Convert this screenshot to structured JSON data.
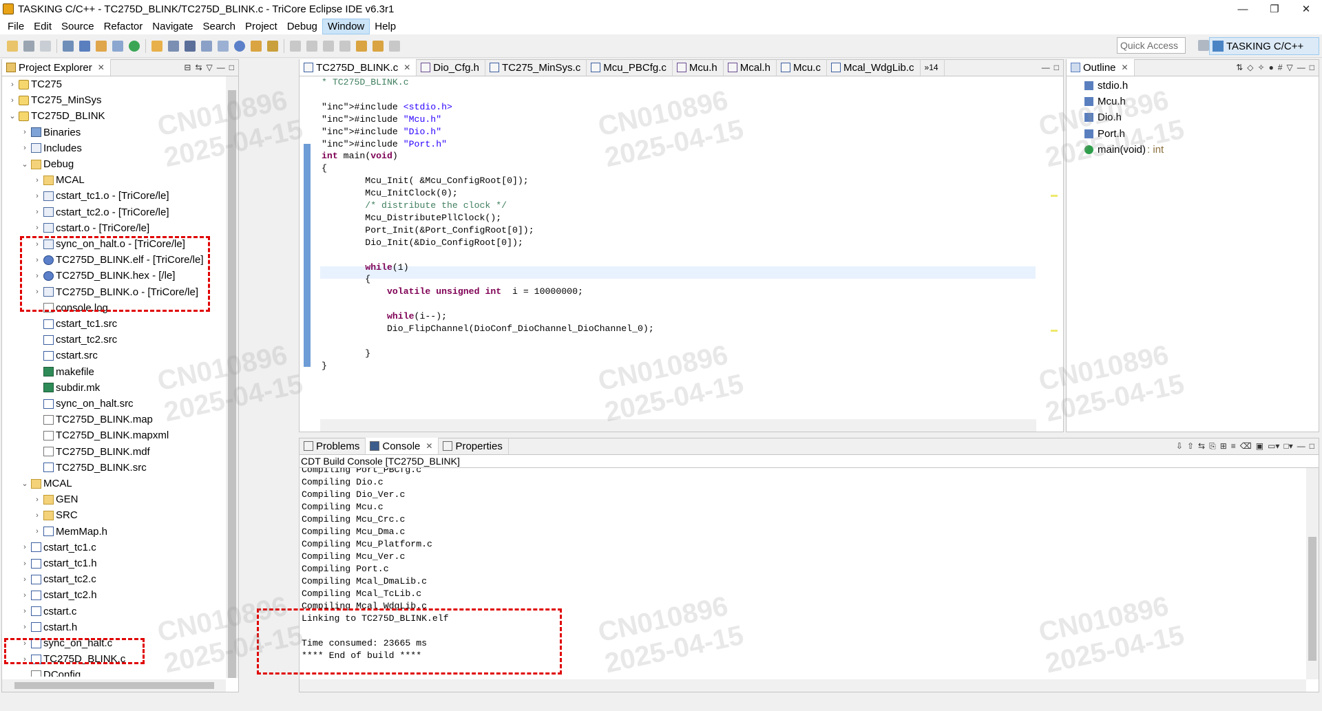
{
  "window": {
    "title": "TASKING C/C++ - TC275D_BLINK/TC275D_BLINK.c - TriCore Eclipse IDE v6.3r1",
    "minimize": "—",
    "maximize": "❐",
    "close": "✕"
  },
  "menu": [
    "File",
    "Edit",
    "Source",
    "Refactor",
    "Navigate",
    "Search",
    "Project",
    "Debug",
    "Window",
    "Help"
  ],
  "toolbar": {
    "quick_access_placeholder": "Quick Access",
    "perspective": "TASKING C/C++"
  },
  "project_explorer": {
    "tab": "Project Explorer",
    "items": [
      {
        "label": "TC275",
        "icon": "project-icon",
        "arrow": "›"
      },
      {
        "label": "TC275_MinSys",
        "icon": "project-icon",
        "arrow": "›"
      },
      {
        "label": "TC275D_BLINK",
        "icon": "project-icon",
        "arrow": "⌄"
      },
      {
        "label": "Binaries",
        "icon": "binaries-icon",
        "arrow": "›"
      },
      {
        "label": "Includes",
        "icon": "includes-icon",
        "arrow": "›"
      },
      {
        "label": "Debug",
        "icon": "folder-icon",
        "arrow": "⌄"
      },
      {
        "label": "MCAL",
        "icon": "folder-icon",
        "arrow": "›"
      },
      {
        "label": "cstart_tc1.o - [TriCore/le]",
        "icon": "object-file-icon",
        "arrow": "›"
      },
      {
        "label": "cstart_tc2.o - [TriCore/le]",
        "icon": "object-file-icon",
        "arrow": "›"
      },
      {
        "label": "cstart.o - [TriCore/le]",
        "icon": "object-file-icon",
        "arrow": "›"
      },
      {
        "label": "sync_on_halt.o - [TriCore/le]",
        "icon": "object-file-icon",
        "arrow": "›"
      },
      {
        "label": "TC275D_BLINK.elf - [TriCore/le]",
        "icon": "elf-gear-icon",
        "arrow": "›"
      },
      {
        "label": "TC275D_BLINK.hex - [/le]",
        "icon": "hex-gear-icon",
        "arrow": "›"
      },
      {
        "label": "TC275D_BLINK.o - [TriCore/le]",
        "icon": "object-file-icon",
        "arrow": "›"
      },
      {
        "label": "console.log",
        "icon": "file-icon",
        "arrow": ""
      },
      {
        "label": "cstart_tc1.src",
        "icon": "source-file-icon",
        "arrow": ""
      },
      {
        "label": "cstart_tc2.src",
        "icon": "source-file-icon",
        "arrow": ""
      },
      {
        "label": "cstart.src",
        "icon": "source-file-icon",
        "arrow": ""
      },
      {
        "label": "makefile",
        "icon": "makefile-icon",
        "arrow": ""
      },
      {
        "label": "subdir.mk",
        "icon": "makefile-icon",
        "arrow": ""
      },
      {
        "label": "sync_on_halt.src",
        "icon": "source-file-icon",
        "arrow": ""
      },
      {
        "label": "TC275D_BLINK.map",
        "icon": "file-icon",
        "arrow": ""
      },
      {
        "label": "TC275D_BLINK.mapxml",
        "icon": "file-icon",
        "arrow": ""
      },
      {
        "label": "TC275D_BLINK.mdf",
        "icon": "file-icon",
        "arrow": ""
      },
      {
        "label": "TC275D_BLINK.src",
        "icon": "source-file-icon",
        "arrow": ""
      },
      {
        "label": "MCAL",
        "icon": "folder-icon",
        "arrow": "⌄"
      },
      {
        "label": "GEN",
        "icon": "folder-icon",
        "arrow": "›"
      },
      {
        "label": "SRC",
        "icon": "folder-icon",
        "arrow": "›"
      },
      {
        "label": "MemMap.h",
        "icon": "header-file-icon",
        "arrow": "›"
      },
      {
        "label": "cstart_tc1.c",
        "icon": "c-file-icon",
        "arrow": "›"
      },
      {
        "label": "cstart_tc1.h",
        "icon": "header-file-icon",
        "arrow": "›"
      },
      {
        "label": "cstart_tc2.c",
        "icon": "c-file-icon",
        "arrow": "›"
      },
      {
        "label": "cstart_tc2.h",
        "icon": "header-file-icon",
        "arrow": "›"
      },
      {
        "label": "cstart.c",
        "icon": "c-file-icon",
        "arrow": "›"
      },
      {
        "label": "cstart.h",
        "icon": "header-file-icon",
        "arrow": "›"
      },
      {
        "label": "sync_on_halt.c",
        "icon": "c-file-icon",
        "arrow": "›"
      },
      {
        "label": "TC275D_BLINK.c",
        "icon": "c-file-icon",
        "arrow": "›"
      },
      {
        "label": "DConfig",
        "icon": "file-icon",
        "arrow": ""
      }
    ]
  },
  "editor": {
    "tabs": [
      "TC275D_BLINK.c",
      "Dio_Cfg.h",
      "TC275_MinSys.c",
      "Mcu_PBCfg.c",
      "Mcu.h",
      "Mcal.h",
      "Mcu.c",
      "Mcal_WdgLib.c"
    ],
    "overflow": "»14",
    "lines": [
      "* TC275D_BLINK.c",
      "",
      "#include <stdio.h>",
      "#include \"Mcu.h\"",
      "#include \"Dio.h\"",
      "#include \"Port.h\"",
      "int main(void)",
      "{",
      "        Mcu_Init( &Mcu_ConfigRoot[0]);",
      "        Mcu_InitClock(0);",
      "        /* distribute the clock */",
      "        Mcu_DistributePllClock();",
      "        Port_Init(&Port_ConfigRoot[0]);",
      "        Dio_Init(&Dio_ConfigRoot[0]);",
      "",
      "        while(1)",
      "        {",
      "            volatile unsigned int  i = 10000000;",
      "",
      "            while(i--);",
      "            Dio_FlipChannel(DioConf_DioChannel_DioChannel_0);",
      "",
      "        }",
      "}"
    ]
  },
  "console": {
    "tabs": [
      "Problems",
      "Console",
      "Properties"
    ],
    "header": "CDT Build Console [TC275D_BLINK]",
    "lines": [
      "Compiling Port_PBCfg.c",
      "Compiling Dio.c",
      "Compiling Dio_Ver.c",
      "Compiling Mcu.c",
      "Compiling Mcu_Crc.c",
      "Compiling Mcu_Dma.c",
      "Compiling Mcu_Platform.c",
      "Compiling Mcu_Ver.c",
      "Compiling Port.c",
      "Compiling Mcal_DmaLib.c",
      "Compiling Mcal_TcLib.c",
      "Compiling Mcal_WdgLib.c",
      "Linking to TC275D_BLINK.elf",
      "",
      "Time consumed: 23665 ms",
      "**** End of build ****"
    ]
  },
  "outline": {
    "tab": "Outline",
    "items": [
      {
        "label": "stdio.h",
        "type": ""
      },
      {
        "label": "Mcu.h",
        "type": ""
      },
      {
        "label": "Dio.h",
        "type": ""
      },
      {
        "label": "Port.h",
        "type": ""
      },
      {
        "label": "main(void)",
        "type": ": int"
      }
    ]
  },
  "watermark": "CN010896\n2025-04-15"
}
